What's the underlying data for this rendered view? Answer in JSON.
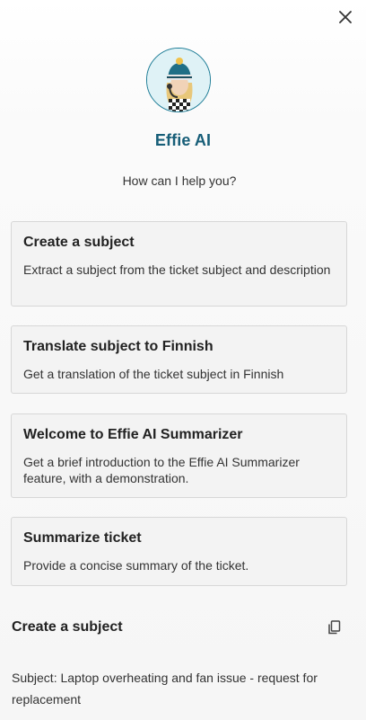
{
  "header": {
    "close_icon": "close-icon",
    "avatar_icon": "assistant-avatar",
    "assistant_name": "Effie AI",
    "greeting": "How can I help you?"
  },
  "actions": [
    {
      "title": "Create a subject",
      "description": "Extract a subject from the ticket subject and description"
    },
    {
      "title": "Translate subject to Finnish",
      "description": "Get a translation of the ticket subject in Finnish"
    },
    {
      "title": "Welcome to Effie AI Summarizer",
      "description": "Get a brief introduction to the Effie AI Summarizer feature, with a demonstration."
    },
    {
      "title": "Summarize ticket",
      "description": "Provide a concise summary of the ticket."
    }
  ],
  "result": {
    "title": "Create a subject",
    "copy_icon": "copy-icon",
    "text": "Subject: Laptop overheating and fan issue - request for replacement"
  },
  "colors": {
    "accent": "#175e78",
    "card_bg": "#f3f3f3",
    "card_border": "#d7d7d7"
  }
}
